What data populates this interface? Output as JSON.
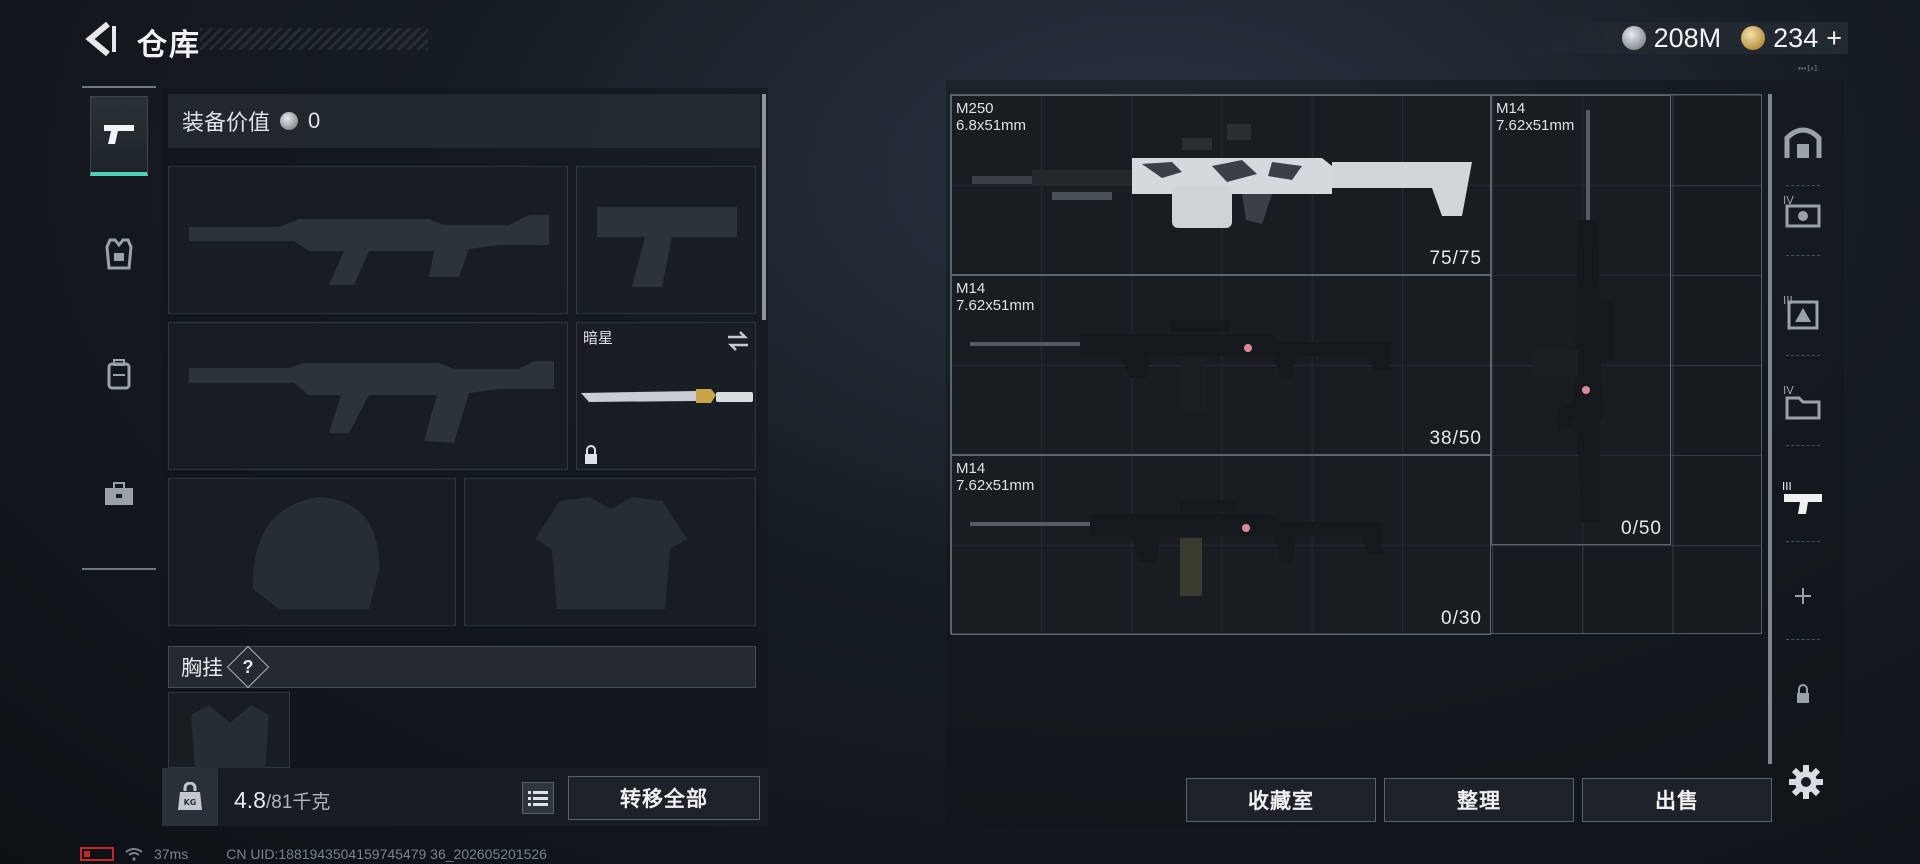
{
  "header": {
    "title": "仓库",
    "currency": [
      {
        "icon": "silver-coin-icon",
        "amount": "208M"
      },
      {
        "icon": "gold-coin-icon",
        "amount": "234"
      }
    ],
    "add_label": "+"
  },
  "equipment": {
    "value_label": "装备价值",
    "value": "0",
    "melee_slot_name": "暗星",
    "chest_rig_label": "胸挂",
    "help_label": "?"
  },
  "footer": {
    "weight_current": "4.8",
    "weight_max": "/81千克",
    "transfer_all_label": "转移全部",
    "collection_label": "收藏室",
    "organize_label": "整理",
    "sell_label": "出售"
  },
  "storage": {
    "items": [
      {
        "name": "M250",
        "caliber": "6.8x51mm",
        "ammo": "75/75"
      },
      {
        "name": "M14",
        "caliber": "7.62x51mm",
        "ammo": "38/50"
      },
      {
        "name": "M14",
        "caliber": "7.62x51mm",
        "ammo": "0/30"
      },
      {
        "name": "M14",
        "caliber": "7.62x51mm",
        "ammo": "0/50"
      }
    ]
  },
  "status": {
    "ping": "37ms",
    "uid": "CN UID:1881943504159745479 36_202605201526"
  },
  "colors": {
    "accent": "#4fd1b7",
    "battery_low": "#c12a2a"
  }
}
